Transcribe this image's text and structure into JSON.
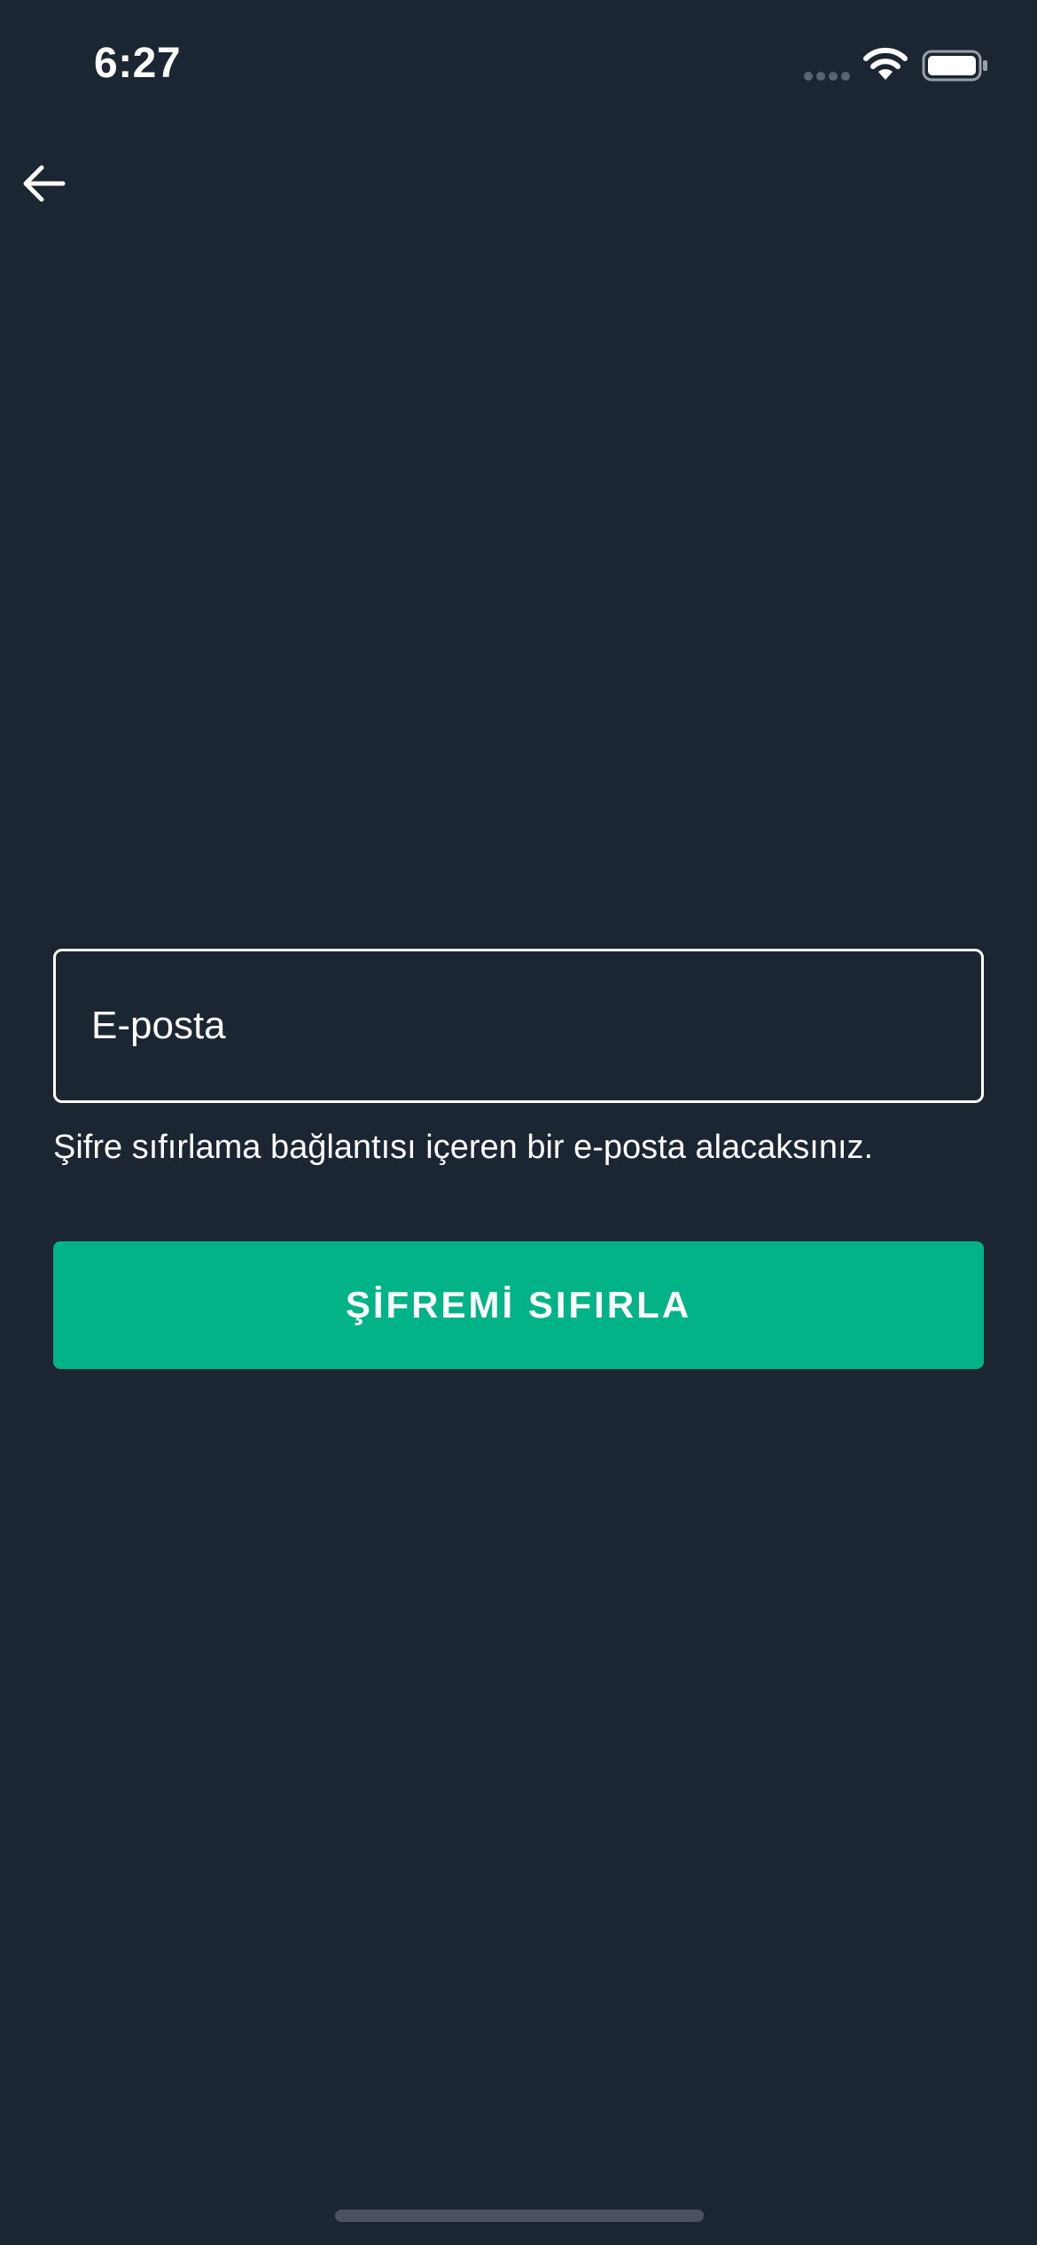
{
  "status_bar": {
    "time": "6:27",
    "signal_icon": "cellular-signal-icon",
    "wifi_icon": "wifi-icon",
    "battery_icon": "battery-icon"
  },
  "navigation": {
    "back_icon": "arrow-left-icon"
  },
  "form": {
    "email_placeholder": "E-posta",
    "email_value": "",
    "helper_text": "Şifre sıfırlama bağlantısı içeren bir e-posta alacaksınız.",
    "submit_label": "ŞİFREMİ SIFIRLA"
  },
  "colors": {
    "background": "#1c2532",
    "accent": "#02b388",
    "text": "#ffffff"
  }
}
